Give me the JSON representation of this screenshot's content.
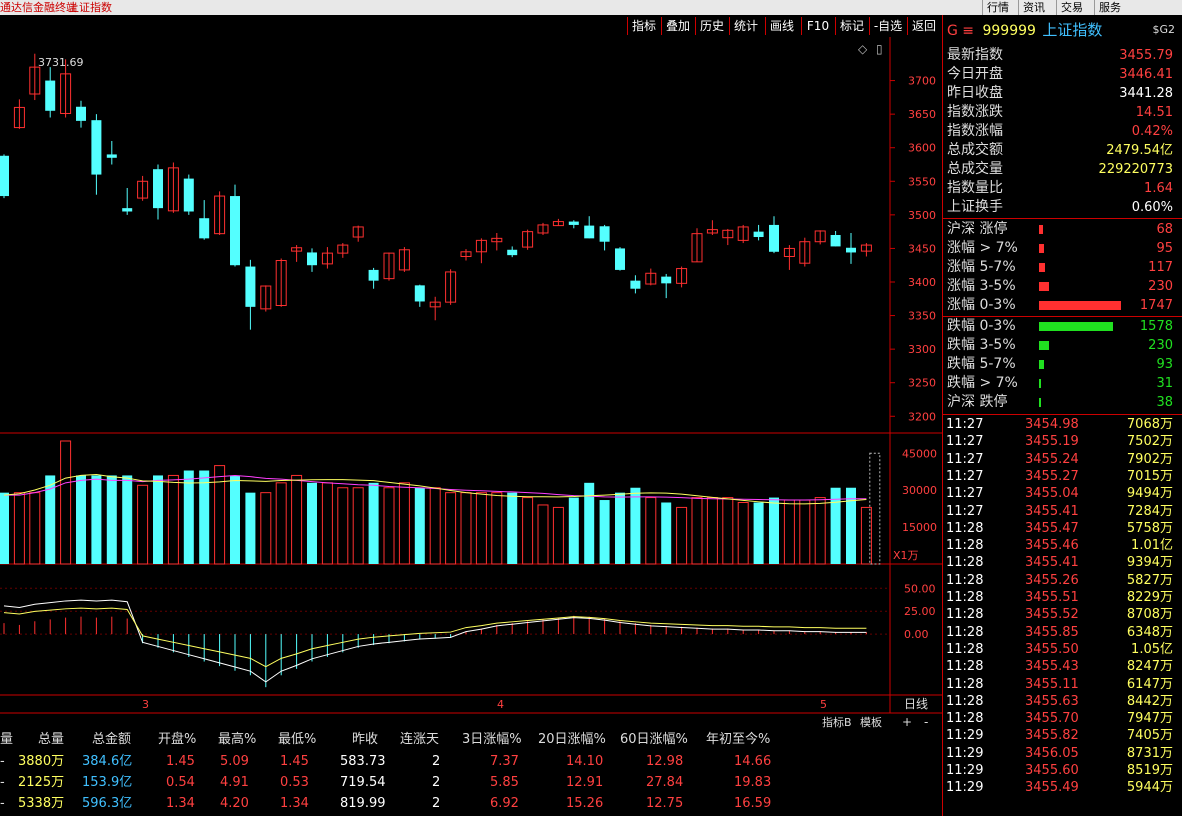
{
  "window": {
    "title": "通达信金融终端",
    "subtitle": "上证指数",
    "menu": [
      "行情",
      "资讯",
      "交易",
      "服务"
    ]
  },
  "toolbar": {
    "buttons": [
      "指标",
      "叠加",
      "历史",
      "统计",
      "画线",
      "F10",
      "标记",
      "-自选",
      "返回"
    ]
  },
  "chart": {
    "peak_label": "3731.69",
    "price_ticks": [
      "3700",
      "3650",
      "3600",
      "3550",
      "3500",
      "3450",
      "3400",
      "3350",
      "3300",
      "3250",
      "3200"
    ],
    "vol_ticks": [
      "45000",
      "30000",
      "15000"
    ],
    "vol_unit": "X1万",
    "macd_ticks": [
      "50.00",
      "25.00",
      "0.00"
    ],
    "month_labels": [
      "3",
      "4",
      "5"
    ],
    "period": "日线",
    "bottom_tabs": [
      "指标B",
      "模板",
      "+",
      "-"
    ]
  },
  "chart_data": {
    "type": "candlestick",
    "price_range": [
      3190,
      3750
    ],
    "volume_range": [
      0,
      50000
    ],
    "macd_range": [
      -60,
      70
    ],
    "candles": [
      [
        3588,
        3528,
        3590,
        3525
      ],
      [
        3630,
        3660,
        3672,
        3628
      ],
      [
        3680,
        3720,
        3740,
        3671
      ],
      [
        3700,
        3655,
        3720,
        3645
      ],
      [
        3651,
        3710,
        3731.69,
        3645
      ],
      [
        3661,
        3640,
        3670,
        3630
      ],
      [
        3641,
        3560,
        3650,
        3530
      ],
      [
        3590,
        3585,
        3610,
        3575
      ],
      [
        3510,
        3505,
        3540,
        3500
      ],
      [
        3525,
        3550,
        3558,
        3521
      ],
      [
        3568,
        3510,
        3575,
        3493
      ],
      [
        3506,
        3570,
        3578,
        3503
      ],
      [
        3554,
        3505,
        3560,
        3500
      ],
      [
        3495,
        3465,
        3522,
        3463
      ],
      [
        3472,
        3528,
        3535,
        3470
      ],
      [
        3528,
        3425,
        3545,
        3423
      ],
      [
        3423,
        3363,
        3433,
        3329
      ],
      [
        3360,
        3394,
        3395,
        3356
      ],
      [
        3365,
        3432,
        3435,
        3363
      ],
      [
        3446,
        3451,
        3455,
        3430
      ],
      [
        3444,
        3425,
        3450,
        3415
      ],
      [
        3427,
        3443,
        3452,
        3420
      ],
      [
        3443,
        3455,
        3458,
        3436
      ],
      [
        3467,
        3482,
        3484,
        3460
      ],
      [
        3418,
        3402,
        3421,
        3390
      ],
      [
        3405,
        3443,
        3444,
        3402
      ],
      [
        3418,
        3448,
        3452,
        3415
      ],
      [
        3395,
        3371,
        3396,
        3363
      ],
      [
        3363,
        3370,
        3378,
        3343
      ],
      [
        3370,
        3415,
        3419,
        3366
      ],
      [
        3438,
        3445,
        3449,
        3432
      ],
      [
        3445,
        3462,
        3465,
        3428
      ],
      [
        3460,
        3465,
        3473,
        3447
      ],
      [
        3448,
        3440,
        3453,
        3437
      ],
      [
        3452,
        3475,
        3478,
        3448
      ],
      [
        3473,
        3485,
        3488,
        3470
      ],
      [
        3484,
        3490,
        3494,
        3484
      ],
      [
        3490,
        3485,
        3492,
        3480
      ],
      [
        3484,
        3465,
        3498,
        3465
      ],
      [
        3483,
        3460,
        3485,
        3447
      ],
      [
        3450,
        3418,
        3452,
        3417
      ],
      [
        3402,
        3390,
        3410,
        3383
      ],
      [
        3397,
        3413,
        3420,
        3395
      ],
      [
        3408,
        3398,
        3412,
        3376
      ],
      [
        3398,
        3420,
        3423,
        3392
      ],
      [
        3430,
        3472,
        3480,
        3430
      ],
      [
        3473,
        3478,
        3492,
        3470
      ],
      [
        3466,
        3477,
        3479,
        3455
      ],
      [
        3462,
        3482,
        3485,
        3458
      ],
      [
        3475,
        3467,
        3485,
        3462
      ],
      [
        3485,
        3445,
        3498,
        3443
      ],
      [
        3438,
        3450,
        3455,
        3418
      ],
      [
        3428,
        3460,
        3466,
        3423
      ],
      [
        3460,
        3476,
        3477,
        3456
      ],
      [
        3470,
        3453,
        3476,
        3453
      ],
      [
        3451,
        3444,
        3473,
        3427
      ],
      [
        3446,
        3455,
        3458,
        3438
      ]
    ],
    "volumes": [
      29000,
      29000,
      29000,
      36000,
      50000,
      36000,
      36000,
      36000,
      36000,
      32000,
      36000,
      36000,
      38000,
      38000,
      40000,
      36000,
      29000,
      29000,
      33000,
      36000,
      33000,
      33000,
      31000,
      31000,
      33000,
      31000,
      33000,
      31000,
      31000,
      29000,
      29000,
      29000,
      29000,
      29000,
      27000,
      24000,
      23000,
      27000,
      33000,
      26000,
      29000,
      31000,
      27000,
      25000,
      23000,
      27000,
      27000,
      27000,
      25000,
      25000,
      27000,
      26000,
      26000,
      27000,
      31000,
      31000,
      23000
    ],
    "macd": [
      12,
      10,
      14,
      16,
      18,
      19,
      18,
      19,
      17,
      -10,
      -15,
      -20,
      -25,
      -30,
      -35,
      -40,
      -45,
      -58,
      -45,
      -38,
      -30,
      -25,
      -20,
      -15,
      -12,
      -10,
      -8,
      -6,
      -5,
      -4,
      3,
      6,
      10,
      12,
      14,
      16,
      18,
      20,
      19,
      17,
      14,
      12,
      10,
      9,
      8,
      7,
      6,
      6,
      5,
      5,
      4,
      4,
      3,
      3,
      2,
      2,
      2
    ],
    "ma_vol": [
      28000,
      28000,
      29000,
      30500,
      33000,
      34000,
      34500,
      34000,
      34000,
      33500,
      34000,
      34200,
      34500,
      35000,
      35500,
      36000,
      35500,
      34800,
      34500,
      34000,
      33500,
      33000,
      32600,
      32200,
      32000,
      31500,
      31200,
      31000,
      30700,
      30300,
      30000,
      29800,
      29500,
      29300,
      29000,
      28700,
      28200,
      27800,
      27600,
      27300,
      27200,
      27300,
      27300,
      27200,
      27000,
      26700,
      26500,
      26400,
      26300,
      26200,
      26100,
      26000,
      26000,
      26100,
      26300,
      26500,
      26500
    ]
  },
  "quote": {
    "code_prefix": "G ≡",
    "code": "999999",
    "name": "上证指数",
    "flag": "$G2",
    "rows": [
      {
        "label": "最新指数",
        "value": "3455.79",
        "color": "#ff4040"
      },
      {
        "label": "今日开盘",
        "value": "3446.41",
        "color": "#ff4040"
      },
      {
        "label": "昨日收盘",
        "value": "3441.28",
        "color": "#ffffff"
      },
      {
        "label": "指数涨跌",
        "value": "14.51",
        "color": "#ff4040"
      },
      {
        "label": "指数涨幅",
        "value": "0.42%",
        "color": "#ff4040"
      },
      {
        "label": "总成交额",
        "value": "2479.54亿",
        "color": "#ffff60"
      },
      {
        "label": "总成交量",
        "value": "229220773",
        "color": "#ffff60"
      },
      {
        "label": "指数量比",
        "value": "1.64",
        "color": "#ff4040"
      },
      {
        "label": "上证换手",
        "value": "0.60%",
        "color": "#ffffff"
      }
    ],
    "breadth_up": [
      {
        "label": "沪深 涨停",
        "value": "68",
        "bar": 4
      },
      {
        "label": "涨幅 > 7%",
        "value": "95",
        "bar": 5
      },
      {
        "label": "涨幅 5-7%",
        "value": "117",
        "bar": 6
      },
      {
        "label": "涨幅 3-5%",
        "value": "230",
        "bar": 10
      },
      {
        "label": "涨幅 0-3%",
        "value": "1747",
        "bar": 82
      }
    ],
    "breadth_down": [
      {
        "label": "跌幅 0-3%",
        "value": "1578",
        "bar": 74
      },
      {
        "label": "跌幅 3-5%",
        "value": "230",
        "bar": 10
      },
      {
        "label": "跌幅 5-7%",
        "value": "93",
        "bar": 5
      },
      {
        "label": "跌幅 > 7%",
        "value": "31",
        "bar": 2
      },
      {
        "label": "沪深 跌停",
        "value": "38",
        "bar": 2
      }
    ],
    "ticks": [
      [
        "11:27",
        "3454.98",
        "7068万"
      ],
      [
        "11:27",
        "3455.19",
        "7502万"
      ],
      [
        "11:27",
        "3455.24",
        "7902万"
      ],
      [
        "11:27",
        "3455.27",
        "7015万"
      ],
      [
        "11:27",
        "3455.04",
        "9494万"
      ],
      [
        "11:27",
        "3455.41",
        "7284万"
      ],
      [
        "11:28",
        "3455.47",
        "5758万"
      ],
      [
        "11:28",
        "3455.46",
        "1.01亿"
      ],
      [
        "11:28",
        "3455.41",
        "9394万"
      ],
      [
        "11:28",
        "3455.26",
        "5827万"
      ],
      [
        "11:28",
        "3455.51",
        "8229万"
      ],
      [
        "11:28",
        "3455.52",
        "8708万"
      ],
      [
        "11:28",
        "3455.85",
        "6348万"
      ],
      [
        "11:28",
        "3455.50",
        "1.05亿"
      ],
      [
        "11:28",
        "3455.43",
        "8247万"
      ],
      [
        "11:28",
        "3455.11",
        "6147万"
      ],
      [
        "11:28",
        "3455.63",
        "8442万"
      ],
      [
        "11:28",
        "3455.70",
        "7947万"
      ],
      [
        "11:29",
        "3455.82",
        "7405万"
      ],
      [
        "11:29",
        "3456.05",
        "8731万"
      ],
      [
        "11:29",
        "3455.60",
        "8519万"
      ],
      [
        "11:29",
        "3455.49",
        "5944万"
      ]
    ]
  },
  "table": {
    "headers": [
      "量",
      "总量",
      "总金额",
      "开盘%",
      "最高%",
      "最低%",
      "昨收",
      "连涨天",
      "3日涨幅%",
      "20日涨幅%",
      "60日涨幅%",
      "年初至今%"
    ],
    "rows": [
      [
        "-",
        "3880万",
        "384.6亿",
        "1.45",
        "5.09",
        "1.45",
        "583.73",
        "2",
        "7.37",
        "14.10",
        "12.98",
        "14.66"
      ],
      [
        "-",
        "2125万",
        "153.9亿",
        "0.54",
        "4.91",
        "0.53",
        "719.54",
        "2",
        "5.85",
        "12.91",
        "27.84",
        "19.83"
      ],
      [
        "-",
        "5338万",
        "596.3亿",
        "1.34",
        "4.20",
        "1.34",
        "819.99",
        "2",
        "6.92",
        "15.26",
        "12.75",
        "16.59"
      ]
    ]
  }
}
